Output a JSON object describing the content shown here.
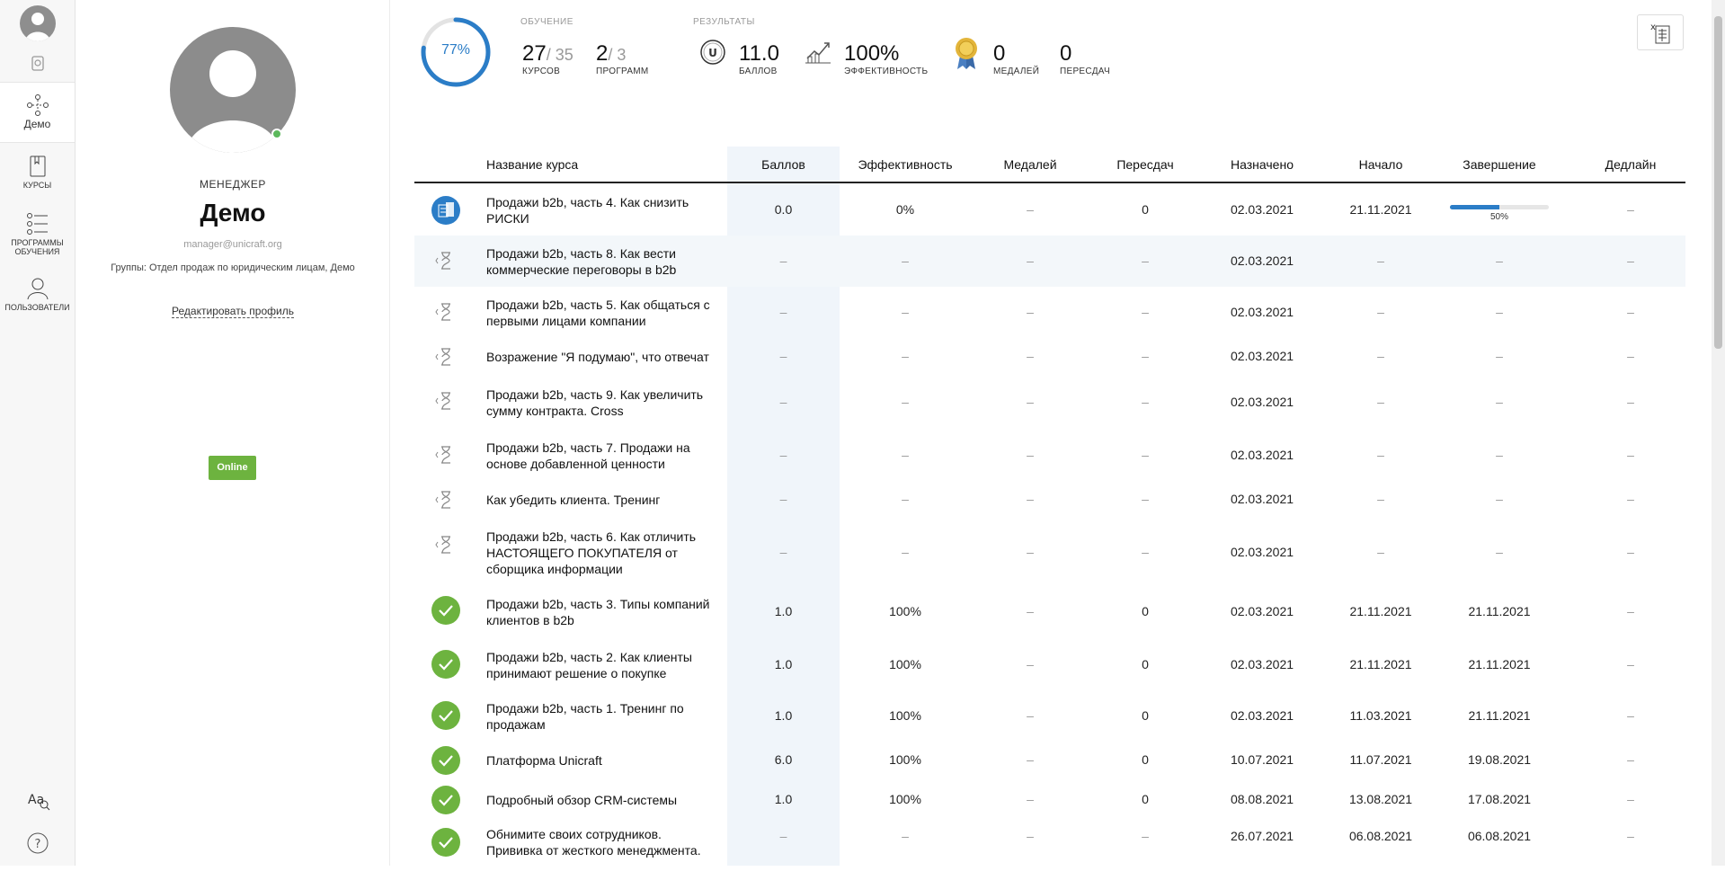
{
  "nav": {
    "items": [
      {
        "label": "Демо",
        "icon": "demo-network-icon"
      },
      {
        "label": "Курсы",
        "icon": "book-icon"
      },
      {
        "label": "Программы обучения",
        "icon": "list-icon"
      },
      {
        "label": "Пользователи",
        "icon": "user-icon"
      }
    ],
    "bottom": [
      {
        "icon": "font-size-icon"
      },
      {
        "icon": "help-icon"
      }
    ]
  },
  "profile": {
    "role": "МЕНЕДЖЕР",
    "name": "Демо",
    "email": "manager@unicraft.org",
    "groups": "Группы: Отдел продаж по юридическим лицам, Демо",
    "edit_label": "Редактировать профиль",
    "status_label": "Online",
    "status_color": "#6db33f"
  },
  "stats": {
    "progress_percent": 77,
    "progress_label": "77%",
    "learning_title": "ОБУЧЕНИЕ",
    "results_title": "РЕЗУЛЬТАТЫ",
    "courses_done": "27",
    "courses_total": "/ 35",
    "courses_label": "КУРСОВ",
    "programs_done": "2",
    "programs_total": "/ 3",
    "programs_label": "ПРОГРАММ",
    "points": "11.0",
    "points_label": "БАЛЛОВ",
    "efficiency": "100%",
    "efficiency_label": "ЭФФЕКТИВНОСТЬ",
    "medals": "0",
    "medals_label": "МЕДАЛЕЙ",
    "retakes": "0",
    "retakes_label": "ПЕРЕСДАЧ"
  },
  "table": {
    "headers": [
      "Название курса",
      "Баллов",
      "Эффективность",
      "Медалей",
      "Пересдач",
      "Назначено",
      "Начало",
      "Завершение",
      "Дедлайн"
    ],
    "rows": [
      {
        "status": "in-progress",
        "title": "Продажи b2b, часть 4. Как снизить РИСКИ",
        "points": "0.0",
        "eff": "0%",
        "medals": "–",
        "retakes": "0",
        "assigned": "02.03.2021",
        "start": "21.11.2021",
        "end": "",
        "progress": 50,
        "progress_label": "50%",
        "deadline": "–"
      },
      {
        "status": "pending",
        "title": "Продажи b2b, часть 8. Как вести коммерческие переговоры в b2b",
        "points": "–",
        "eff": "–",
        "medals": "–",
        "retakes": "–",
        "assigned": "02.03.2021",
        "start": "–",
        "end": "–",
        "deadline": "–"
      },
      {
        "status": "pending",
        "title": "Продажи b2b, часть 5. Как общаться с первыми лицами компании",
        "points": "–",
        "eff": "–",
        "medals": "–",
        "retakes": "–",
        "assigned": "02.03.2021",
        "start": "–",
        "end": "–",
        "deadline": "–"
      },
      {
        "status": "pending",
        "title": "Возражение \"Я подумаю\", что отвечат",
        "points": "–",
        "eff": "–",
        "medals": "–",
        "retakes": "–",
        "assigned": "02.03.2021",
        "start": "–",
        "end": "–",
        "deadline": "–"
      },
      {
        "status": "pending",
        "title": "Продажи b2b, часть 9. Как увеличить сумму контракта. Cross",
        "points": "–",
        "eff": "–",
        "medals": "–",
        "retakes": "–",
        "assigned": "02.03.2021",
        "start": "–",
        "end": "–",
        "deadline": "–"
      },
      {
        "status": "pending",
        "title": "Продажи b2b, часть 7. Продажи на основе добавленной ценности",
        "points": "–",
        "eff": "–",
        "medals": "–",
        "retakes": "–",
        "assigned": "02.03.2021",
        "start": "–",
        "end": "–",
        "deadline": "–"
      },
      {
        "status": "pending",
        "title": "Как убедить клиента. Тренинг",
        "points": "–",
        "eff": "–",
        "medals": "–",
        "retakes": "–",
        "assigned": "02.03.2021",
        "start": "–",
        "end": "–",
        "deadline": "–"
      },
      {
        "status": "pending",
        "title": "Продажи b2b, часть 6. Как отличить НАСТОЯЩЕГО ПОКУПАТЕЛЯ от сборщика информации",
        "points": "–",
        "eff": "–",
        "medals": "–",
        "retakes": "–",
        "assigned": "02.03.2021",
        "start": "–",
        "end": "–",
        "deadline": "–"
      },
      {
        "status": "done",
        "title": "Продажи b2b, часть 3. Типы компаний клиентов в b2b",
        "points": "1.0",
        "eff": "100%",
        "medals": "–",
        "retakes": "0",
        "assigned": "02.03.2021",
        "start": "21.11.2021",
        "end": "21.11.2021",
        "deadline": "–"
      },
      {
        "status": "done",
        "title": "Продажи b2b, часть 2. Как клиенты принимают решение о покупке",
        "points": "1.0",
        "eff": "100%",
        "medals": "–",
        "retakes": "0",
        "assigned": "02.03.2021",
        "start": "21.11.2021",
        "end": "21.11.2021",
        "deadline": "–"
      },
      {
        "status": "done",
        "title": "Продажи b2b, часть 1. Тренинг по продажам",
        "points": "1.0",
        "eff": "100%",
        "medals": "–",
        "retakes": "0",
        "assigned": "02.03.2021",
        "start": "11.03.2021",
        "end": "21.11.2021",
        "deadline": "–"
      },
      {
        "status": "done",
        "title": "Платформа Unicraft",
        "points": "6.0",
        "eff": "100%",
        "medals": "–",
        "retakes": "0",
        "assigned": "10.07.2021",
        "start": "11.07.2021",
        "end": "19.08.2021",
        "deadline": "–"
      },
      {
        "status": "done",
        "title": "Подробный обзор CRM-системы",
        "points": "1.0",
        "eff": "100%",
        "medals": "–",
        "retakes": "0",
        "assigned": "08.08.2021",
        "start": "13.08.2021",
        "end": "17.08.2021",
        "deadline": "–"
      },
      {
        "status": "done",
        "title": "Обнимите своих сотрудников. Прививка от жесткого менеджмента.",
        "points": "–",
        "eff": "–",
        "medals": "–",
        "retakes": "–",
        "assigned": "26.07.2021",
        "start": "06.08.2021",
        "end": "06.08.2021",
        "deadline": "–"
      }
    ]
  },
  "colors": {
    "accent": "#2b7dc7",
    "done": "#6db33f",
    "highlight_column": "#f0f5fa"
  }
}
